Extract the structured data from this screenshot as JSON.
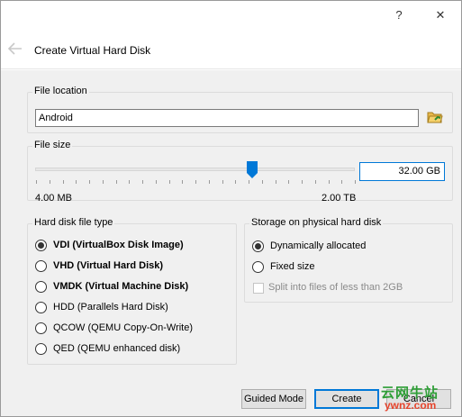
{
  "window": {
    "help_glyph": "?",
    "close_glyph": "✕"
  },
  "wizard": {
    "title": "Create Virtual Hard Disk"
  },
  "file_location": {
    "legend": "File location",
    "value": "Android"
  },
  "file_size": {
    "legend": "File size",
    "value": "32.00 GB",
    "slider_fraction": 0.68,
    "min_label": "4.00 MB",
    "max_label": "2.00 TB"
  },
  "disk_type": {
    "legend": "Hard disk file type",
    "options": [
      {
        "label": "VDI (VirtualBox Disk Image)",
        "selected": true
      },
      {
        "label": "VHD (Virtual Hard Disk)",
        "selected": false
      },
      {
        "label": "VMDK (Virtual Machine Disk)",
        "selected": false
      },
      {
        "label": "HDD (Parallels Hard Disk)",
        "selected": false
      },
      {
        "label": "QCOW (QEMU Copy-On-Write)",
        "selected": false
      },
      {
        "label": "QED (QEMU enhanced disk)",
        "selected": false
      }
    ]
  },
  "storage": {
    "legend": "Storage on physical hard disk",
    "options": [
      {
        "label": "Dynamically allocated",
        "selected": true
      },
      {
        "label": "Fixed size",
        "selected": false
      }
    ],
    "split_label": "Split into files of less than 2GB",
    "split_checked": false
  },
  "buttons": {
    "guided": "Guided Mode",
    "create": "Create",
    "cancel": "Cancel"
  },
  "watermark": {
    "cn": "云网牛站",
    "en": "ywnz.com"
  },
  "colors": {
    "accent": "#0078d7",
    "watermark_green": "#2e9e36",
    "watermark_red": "#e6442c"
  }
}
